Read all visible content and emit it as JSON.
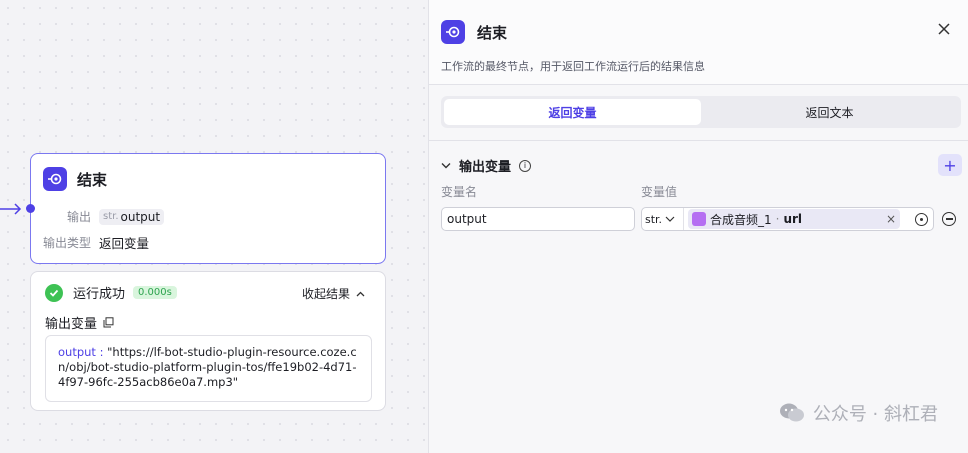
{
  "node": {
    "title": "结束",
    "output_label": "输出",
    "output_type_tag": "str.",
    "output_var": "output",
    "output_type_label": "输出类型",
    "output_type_value": "返回变量"
  },
  "result": {
    "status": "运行成功",
    "duration": "0.000s",
    "collapse_label": "收起结果",
    "section_label": "输出变量",
    "output_key": "output",
    "output_value": "\"https://lf-bot-studio-plugin-resource.coze.cn/obj/bot-studio-platform-plugin-tos/ffe19b02-4d71-4f97-96fc-255acb86e0a7.mp3\""
  },
  "panel": {
    "title": "结束",
    "description": "工作流的最终节点，用于返回工作流运行后的结果信息",
    "tabs": [
      "返回变量",
      "返回文本"
    ],
    "active_tab": 0,
    "section_title": "输出变量",
    "col_name": "变量名",
    "col_value": "变量值",
    "var_name": "output",
    "var_type": "str.",
    "ref_source": "合成音频_1",
    "ref_field": "url"
  },
  "watermark": "公众号 · 斜杠君",
  "colors": {
    "accent": "#4e40e5",
    "success": "#3ec254",
    "ref_icon": "#b56ff2"
  }
}
